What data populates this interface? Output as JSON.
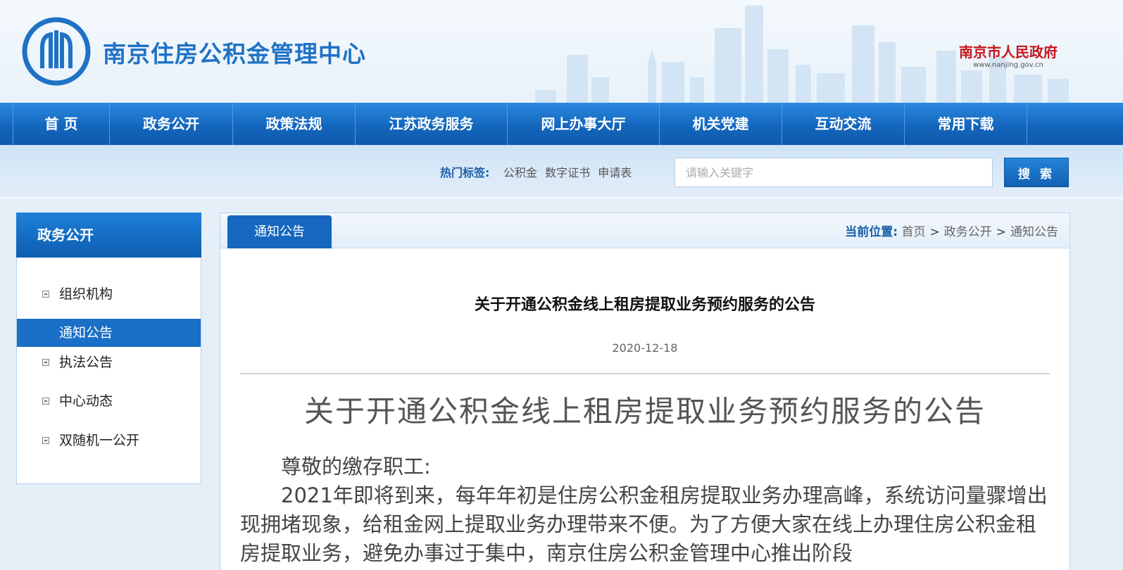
{
  "header": {
    "site_title": "南京住房公积金管理中心",
    "gov_name": "南京市人民政府",
    "gov_url": "www.nanjing.gov.cn"
  },
  "nav": {
    "items": [
      "首 页",
      "政务公开",
      "政策法规",
      "江苏政务服务",
      "网上办事大厅",
      "机关党建",
      "互动交流",
      "常用下载"
    ]
  },
  "search": {
    "hot_label": "热门标签:",
    "hot_tags": [
      "公积金",
      "数字证书",
      "申请表"
    ],
    "placeholder": "请输入关键字",
    "button_label": "搜 索"
  },
  "sidebar": {
    "title": "政务公开",
    "items": [
      {
        "label": "组织机构",
        "active": false
      },
      {
        "label": "通知公告",
        "active": true
      },
      {
        "label": "执法公告",
        "active": false
      },
      {
        "label": "中心动态",
        "active": false
      },
      {
        "label": "双随机一公开",
        "active": false
      }
    ]
  },
  "main": {
    "tab_label": "通知公告",
    "breadcrumb": {
      "label": "当前位置:",
      "items": [
        "首页",
        "政务公开",
        "通知公告"
      ],
      "separator": ">"
    },
    "article_title": "关于开通公积金线上租房提取业务预约服务的公告",
    "date": "2020-12-18",
    "doc_title": "关于开通公积金线上租房提取业务预约服务的公告",
    "greeting": "尊敬的缴存职工:",
    "paragraph": "2021年即将到来，每年年初是住房公积金租房提取业务办理高峰，系统访问量骤增出现拥堵现象，给租金网上提取业务办理带来不便。为了方便大家在线上办理住房公积金租房提取业务，避免办事过于集中，南京住房公积金管理中心推出阶段"
  },
  "colors": {
    "brand_blue": "#1667bd",
    "title_blue": "#1f72c4",
    "gov_red": "#c8151d"
  }
}
